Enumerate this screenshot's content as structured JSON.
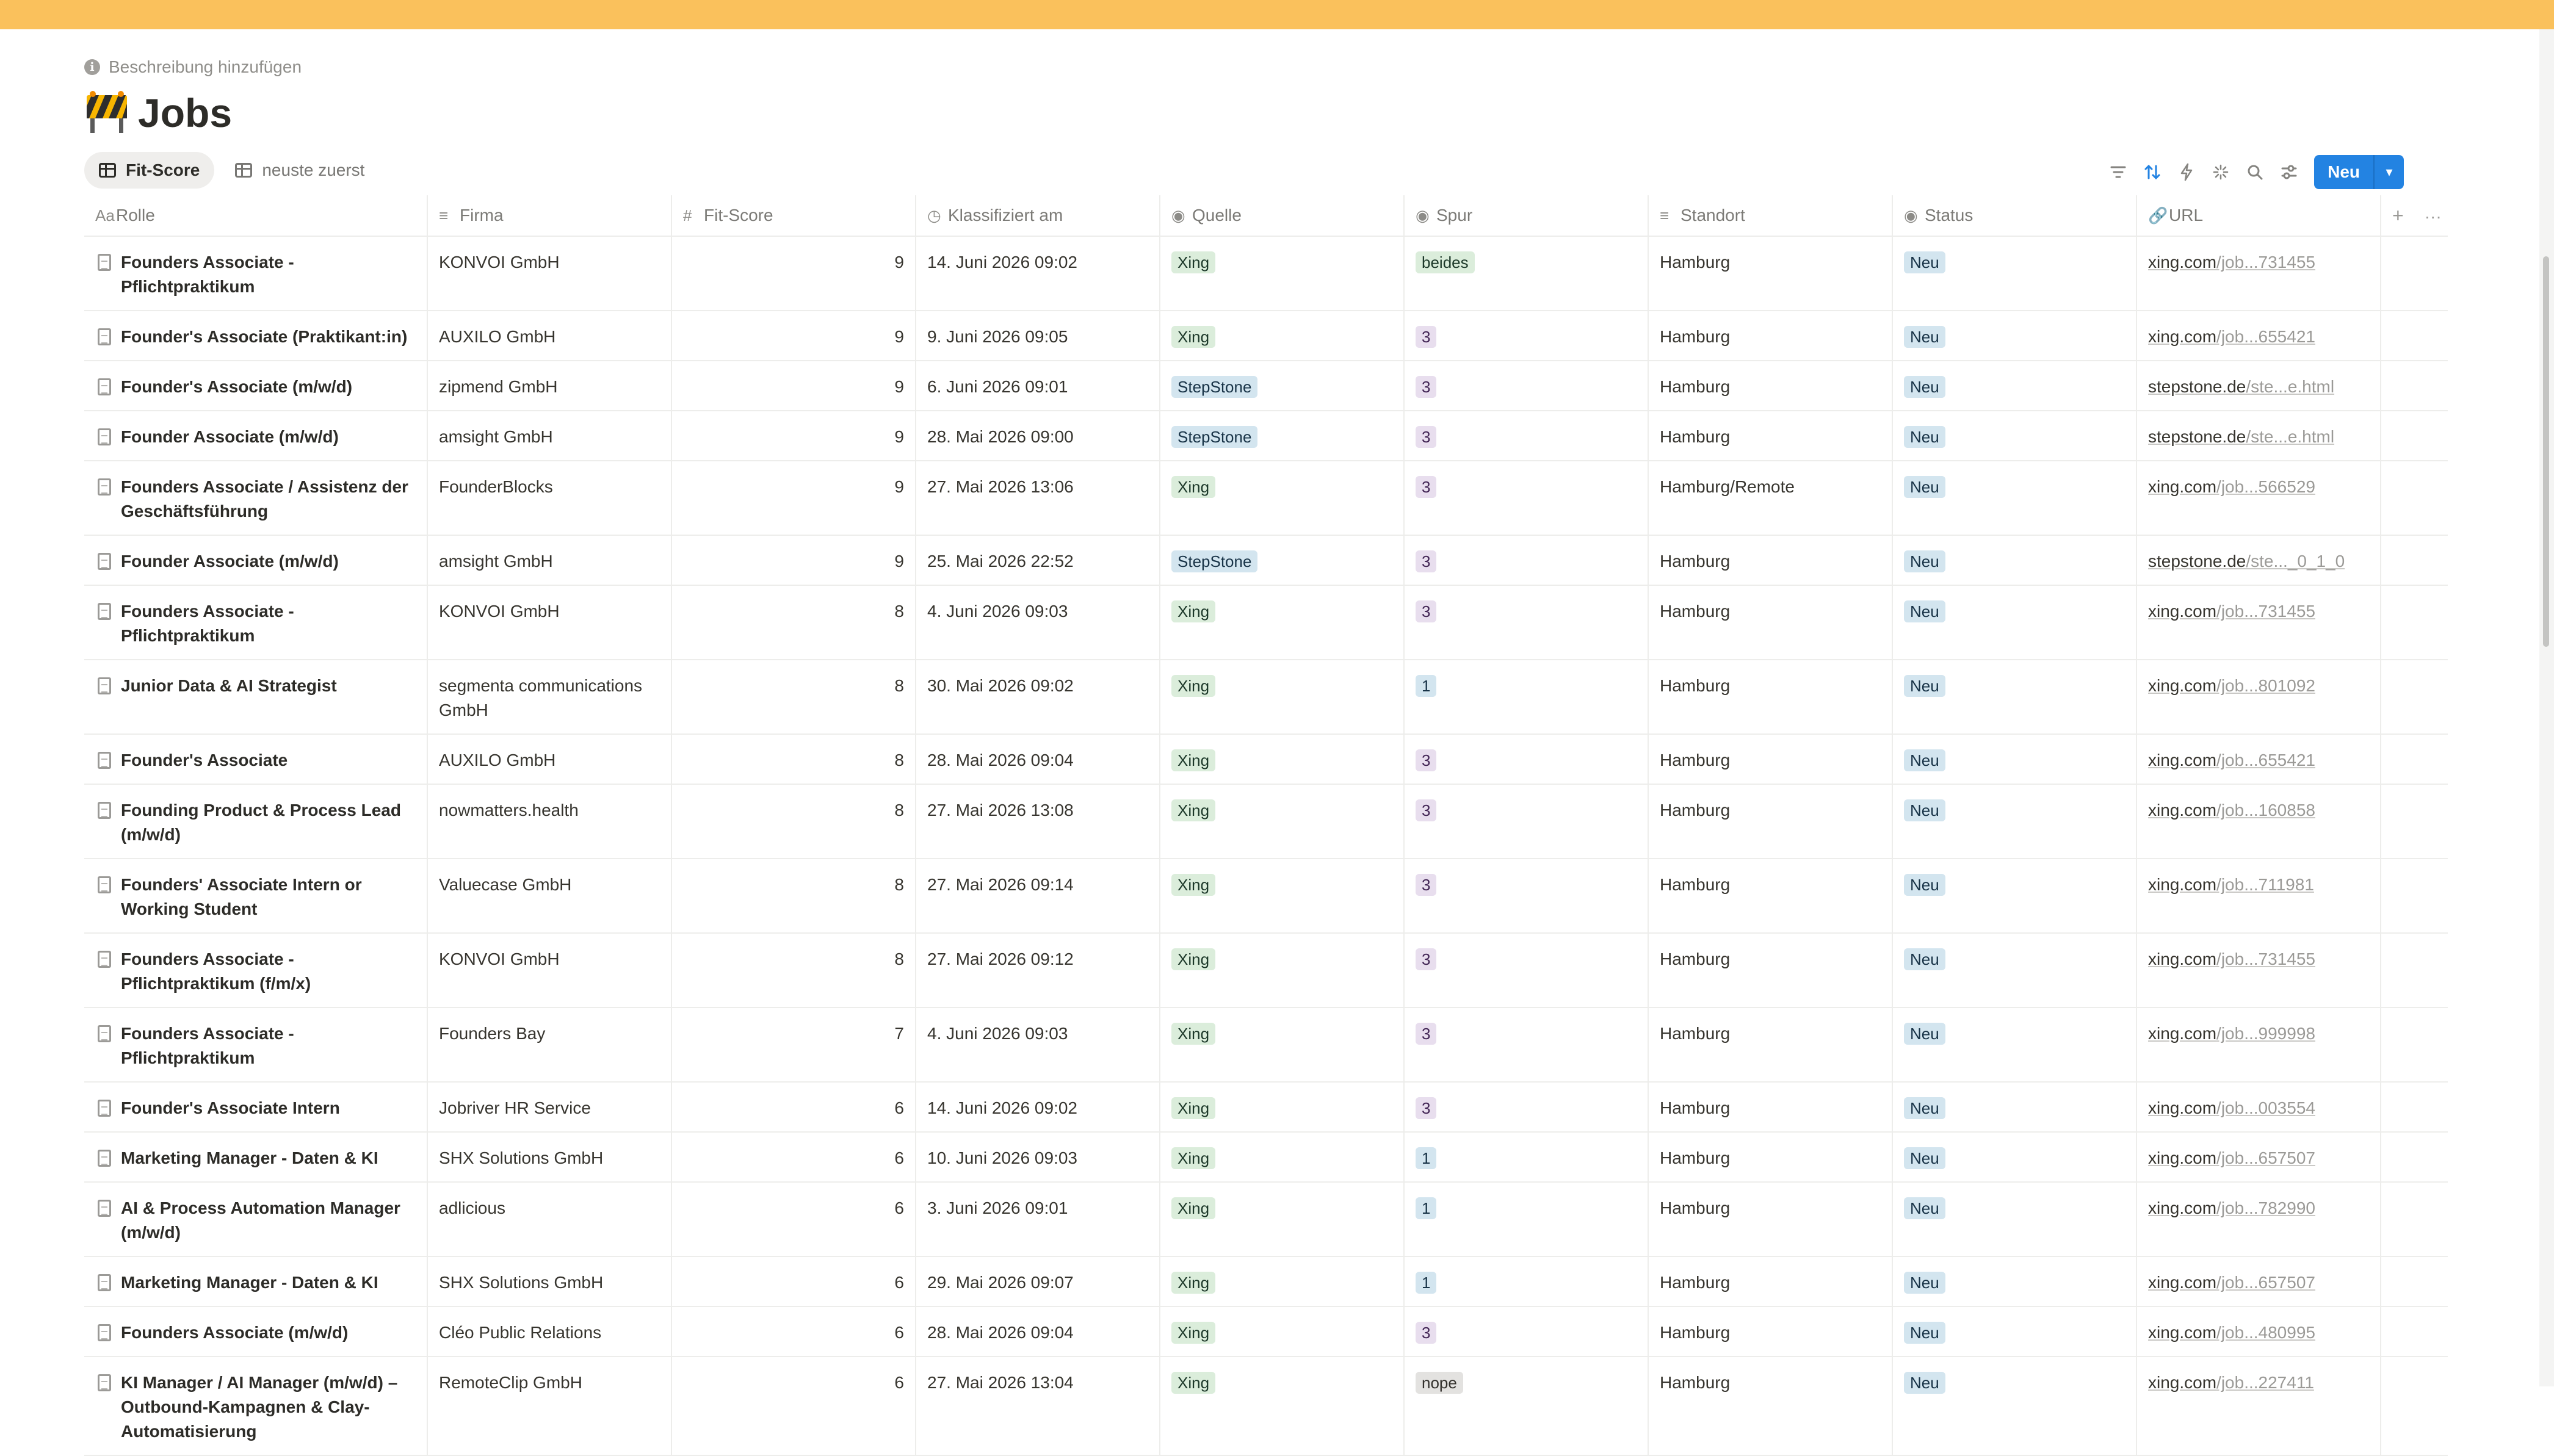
{
  "page": {
    "description": "Beschreibung hinzufügen",
    "title": "Jobs",
    "title_icon": "construction-barrier-icon"
  },
  "views": [
    {
      "label": "Fit-Score",
      "active": true
    },
    {
      "label": "neuste zuerst",
      "active": false
    }
  ],
  "toolbar": {
    "icons": [
      "filter-icon",
      "sort-icon",
      "automation-icon",
      "layout-icon",
      "search-icon",
      "settings-icon"
    ],
    "new_label": "Neu"
  },
  "columns": [
    {
      "label": "Rolle",
      "icon": "title-icon"
    },
    {
      "label": "Firma",
      "icon": "text-icon"
    },
    {
      "label": "Fit-Score",
      "icon": "number-icon"
    },
    {
      "label": "Klassifiziert am",
      "icon": "clock-icon"
    },
    {
      "label": "Quelle",
      "icon": "select-icon"
    },
    {
      "label": "Spur",
      "icon": "select-icon"
    },
    {
      "label": "Standort",
      "icon": "text-icon"
    },
    {
      "label": "Status",
      "icon": "select-icon"
    },
    {
      "label": "URL",
      "icon": "link-icon"
    }
  ],
  "colors": {
    "banner": "#fac15c",
    "accent": "#2383e2"
  },
  "rows": [
    {
      "rolle": "Founders Associate - Pflichtpraktikum",
      "firma": "KONVOI GmbH",
      "fit": "9",
      "datum": "14. Juni 2026 09:02",
      "quelle": "Xing",
      "spur": "beides",
      "standort": "Hamburg",
      "status": "Neu",
      "url_host": "xing.com",
      "url_path": "/job...731455"
    },
    {
      "rolle": "Founder's Associate (Praktikant:in)",
      "firma": "AUXILO GmbH",
      "fit": "9",
      "datum": "9. Juni 2026 09:05",
      "quelle": "Xing",
      "spur": "3",
      "standort": "Hamburg",
      "status": "Neu",
      "url_host": "xing.com",
      "url_path": "/job...655421"
    },
    {
      "rolle": "Founder's Associate (m/w/d)",
      "firma": "zipmend GmbH",
      "fit": "9",
      "datum": "6. Juni 2026 09:01",
      "quelle": "StepStone",
      "spur": "3",
      "standort": "Hamburg",
      "status": "Neu",
      "url_host": "stepstone.de",
      "url_path": "/ste...e.html"
    },
    {
      "rolle": "Founder Associate (m/w/d)",
      "firma": "amsight GmbH",
      "fit": "9",
      "datum": "28. Mai 2026 09:00",
      "quelle": "StepStone",
      "spur": "3",
      "standort": "Hamburg",
      "status": "Neu",
      "url_host": "stepstone.de",
      "url_path": "/ste...e.html"
    },
    {
      "rolle": "Founders Associate / Assistenz der Geschäftsführung",
      "firma": "FounderBlocks",
      "fit": "9",
      "datum": "27. Mai 2026 13:06",
      "quelle": "Xing",
      "spur": "3",
      "standort": "Hamburg/Remote",
      "status": "Neu",
      "url_host": "xing.com",
      "url_path": "/job...566529"
    },
    {
      "rolle": "Founder Associate (m/w/d)",
      "firma": "amsight GmbH",
      "fit": "9",
      "datum": "25. Mai 2026 22:52",
      "quelle": "StepStone",
      "spur": "3",
      "standort": "Hamburg",
      "status": "Neu",
      "url_host": "stepstone.de",
      "url_path": "/ste..._0_1_0"
    },
    {
      "rolle": "Founders Associate - Pflichtpraktikum",
      "firma": "KONVOI GmbH",
      "fit": "8",
      "datum": "4. Juni 2026 09:03",
      "quelle": "Xing",
      "spur": "3",
      "standort": "Hamburg",
      "status": "Neu",
      "url_host": "xing.com",
      "url_path": "/job...731455"
    },
    {
      "rolle": "Junior Data & AI Strategist",
      "firma": "segmenta communications GmbH",
      "fit": "8",
      "datum": "30. Mai 2026 09:02",
      "quelle": "Xing",
      "spur": "1",
      "standort": "Hamburg",
      "status": "Neu",
      "url_host": "xing.com",
      "url_path": "/job...801092"
    },
    {
      "rolle": "Founder's Associate",
      "firma": "AUXILO GmbH",
      "fit": "8",
      "datum": "28. Mai 2026 09:04",
      "quelle": "Xing",
      "spur": "3",
      "standort": "Hamburg",
      "status": "Neu",
      "url_host": "xing.com",
      "url_path": "/job...655421"
    },
    {
      "rolle": "Founding Product & Process Lead (m/w/d)",
      "firma": "nowmatters.health",
      "fit": "8",
      "datum": "27. Mai 2026 13:08",
      "quelle": "Xing",
      "spur": "3",
      "standort": "Hamburg",
      "status": "Neu",
      "url_host": "xing.com",
      "url_path": "/job...160858"
    },
    {
      "rolle": "Founders' Associate Intern or Working Student",
      "firma": "Valuecase GmbH",
      "fit": "8",
      "datum": "27. Mai 2026 09:14",
      "quelle": "Xing",
      "spur": "3",
      "standort": "Hamburg",
      "status": "Neu",
      "url_host": "xing.com",
      "url_path": "/job...711981"
    },
    {
      "rolle": "Founders Associate - Pflichtpraktikum (f/m/x)",
      "firma": "KONVOI GmbH",
      "fit": "8",
      "datum": "27. Mai 2026 09:12",
      "quelle": "Xing",
      "spur": "3",
      "standort": "Hamburg",
      "status": "Neu",
      "url_host": "xing.com",
      "url_path": "/job...731455"
    },
    {
      "rolle": "Founders Associate - Pflichtpraktikum",
      "firma": "Founders Bay",
      "fit": "7",
      "datum": "4. Juni 2026 09:03",
      "quelle": "Xing",
      "spur": "3",
      "standort": "Hamburg",
      "status": "Neu",
      "url_host": "xing.com",
      "url_path": "/job...999998"
    },
    {
      "rolle": "Founder's Associate Intern",
      "firma": "Jobriver HR Service",
      "fit": "6",
      "datum": "14. Juni 2026 09:02",
      "quelle": "Xing",
      "spur": "3",
      "standort": "Hamburg",
      "status": "Neu",
      "url_host": "xing.com",
      "url_path": "/job...003554"
    },
    {
      "rolle": "Marketing Manager - Daten & KI",
      "firma": "SHX Solutions GmbH",
      "fit": "6",
      "datum": "10. Juni 2026 09:03",
      "quelle": "Xing",
      "spur": "1",
      "standort": "Hamburg",
      "status": "Neu",
      "url_host": "xing.com",
      "url_path": "/job...657507"
    },
    {
      "rolle": "AI & Process Automation Manager (m/w/d)",
      "firma": "adlicious",
      "fit": "6",
      "datum": "3. Juni 2026 09:01",
      "quelle": "Xing",
      "spur": "1",
      "standort": "Hamburg",
      "status": "Neu",
      "url_host": "xing.com",
      "url_path": "/job...782990"
    },
    {
      "rolle": "Marketing Manager - Daten & KI",
      "firma": "SHX Solutions GmbH",
      "fit": "6",
      "datum": "29. Mai 2026 09:07",
      "quelle": "Xing",
      "spur": "1",
      "standort": "Hamburg",
      "status": "Neu",
      "url_host": "xing.com",
      "url_path": "/job...657507"
    },
    {
      "rolle": "Founders Associate (m/w/d)",
      "firma": "Cléo Public Relations",
      "fit": "6",
      "datum": "28. Mai 2026 09:04",
      "quelle": "Xing",
      "spur": "3",
      "standort": "Hamburg",
      "status": "Neu",
      "url_host": "xing.com",
      "url_path": "/job...480995"
    },
    {
      "rolle": "KI Manager / AI Manager (m/w/d) – Outbound-Kampagnen & Clay-Automatisierung",
      "firma": "RemoteClip GmbH",
      "fit": "6",
      "datum": "27. Mai 2026 13:04",
      "quelle": "Xing",
      "spur": "nope",
      "standort": "Hamburg",
      "status": "Neu",
      "url_host": "xing.com",
      "url_path": "/job...227411"
    }
  ]
}
